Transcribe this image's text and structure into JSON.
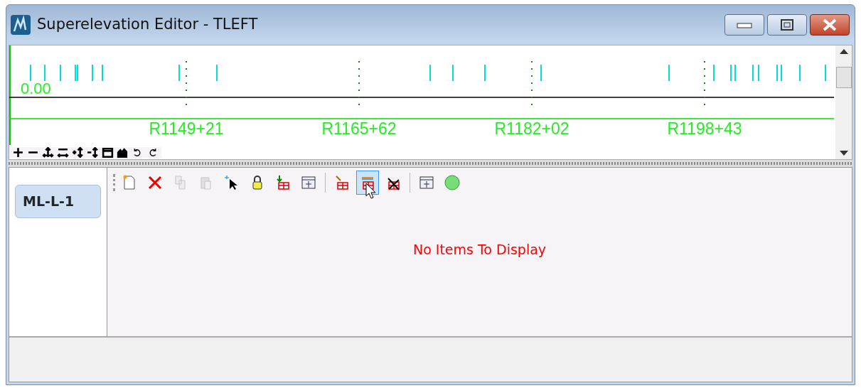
{
  "window": {
    "title": "Superelevation Editor - TLEFT"
  },
  "profile": {
    "value_label": "0.00",
    "stations": [
      "R1149+21",
      "R1165+62",
      "R1182+02",
      "R1198+43"
    ]
  },
  "tabs": [
    {
      "label": "ML-L-1",
      "selected": true
    }
  ],
  "toolbar": [
    {
      "kind": "new",
      "disabled": false,
      "selected": false
    },
    {
      "kind": "delete",
      "disabled": false,
      "selected": false
    },
    {
      "kind": "copy",
      "disabled": true,
      "selected": false
    },
    {
      "kind": "paste",
      "disabled": true,
      "selected": false
    },
    {
      "kind": "select",
      "disabled": false,
      "selected": false
    },
    {
      "kind": "lock",
      "disabled": false,
      "selected": false
    },
    {
      "kind": "insert",
      "disabled": false,
      "selected": false
    },
    {
      "kind": "fit",
      "disabled": false,
      "selected": false
    },
    {
      "kind": "separator"
    },
    {
      "kind": "edit",
      "disabled": false,
      "selected": false
    },
    {
      "kind": "color",
      "disabled": false,
      "selected": true
    },
    {
      "kind": "remove",
      "disabled": false,
      "selected": false
    },
    {
      "kind": "separator"
    },
    {
      "kind": "fit",
      "disabled": false,
      "selected": false
    },
    {
      "kind": "status",
      "disabled": false,
      "selected": false
    }
  ],
  "empty_message": "No Items To Display"
}
